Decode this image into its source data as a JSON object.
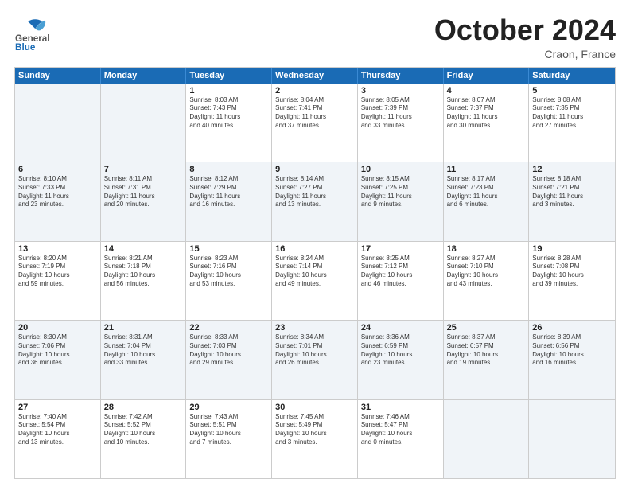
{
  "header": {
    "logo_general": "General",
    "logo_blue": "Blue",
    "month_title": "October 2024",
    "location": "Craon, France"
  },
  "calendar": {
    "days": [
      "Sunday",
      "Monday",
      "Tuesday",
      "Wednesday",
      "Thursday",
      "Friday",
      "Saturday"
    ],
    "rows": [
      [
        {
          "day": "",
          "info": ""
        },
        {
          "day": "",
          "info": ""
        },
        {
          "day": "1",
          "info": "Sunrise: 8:03 AM\nSunset: 7:43 PM\nDaylight: 11 hours\nand 40 minutes."
        },
        {
          "day": "2",
          "info": "Sunrise: 8:04 AM\nSunset: 7:41 PM\nDaylight: 11 hours\nand 37 minutes."
        },
        {
          "day": "3",
          "info": "Sunrise: 8:05 AM\nSunset: 7:39 PM\nDaylight: 11 hours\nand 33 minutes."
        },
        {
          "day": "4",
          "info": "Sunrise: 8:07 AM\nSunset: 7:37 PM\nDaylight: 11 hours\nand 30 minutes."
        },
        {
          "day": "5",
          "info": "Sunrise: 8:08 AM\nSunset: 7:35 PM\nDaylight: 11 hours\nand 27 minutes."
        }
      ],
      [
        {
          "day": "6",
          "info": "Sunrise: 8:10 AM\nSunset: 7:33 PM\nDaylight: 11 hours\nand 23 minutes."
        },
        {
          "day": "7",
          "info": "Sunrise: 8:11 AM\nSunset: 7:31 PM\nDaylight: 11 hours\nand 20 minutes."
        },
        {
          "day": "8",
          "info": "Sunrise: 8:12 AM\nSunset: 7:29 PM\nDaylight: 11 hours\nand 16 minutes."
        },
        {
          "day": "9",
          "info": "Sunrise: 8:14 AM\nSunset: 7:27 PM\nDaylight: 11 hours\nand 13 minutes."
        },
        {
          "day": "10",
          "info": "Sunrise: 8:15 AM\nSunset: 7:25 PM\nDaylight: 11 hours\nand 9 minutes."
        },
        {
          "day": "11",
          "info": "Sunrise: 8:17 AM\nSunset: 7:23 PM\nDaylight: 11 hours\nand 6 minutes."
        },
        {
          "day": "12",
          "info": "Sunrise: 8:18 AM\nSunset: 7:21 PM\nDaylight: 11 hours\nand 3 minutes."
        }
      ],
      [
        {
          "day": "13",
          "info": "Sunrise: 8:20 AM\nSunset: 7:19 PM\nDaylight: 10 hours\nand 59 minutes."
        },
        {
          "day": "14",
          "info": "Sunrise: 8:21 AM\nSunset: 7:18 PM\nDaylight: 10 hours\nand 56 minutes."
        },
        {
          "day": "15",
          "info": "Sunrise: 8:23 AM\nSunset: 7:16 PM\nDaylight: 10 hours\nand 53 minutes."
        },
        {
          "day": "16",
          "info": "Sunrise: 8:24 AM\nSunset: 7:14 PM\nDaylight: 10 hours\nand 49 minutes."
        },
        {
          "day": "17",
          "info": "Sunrise: 8:25 AM\nSunset: 7:12 PM\nDaylight: 10 hours\nand 46 minutes."
        },
        {
          "day": "18",
          "info": "Sunrise: 8:27 AM\nSunset: 7:10 PM\nDaylight: 10 hours\nand 43 minutes."
        },
        {
          "day": "19",
          "info": "Sunrise: 8:28 AM\nSunset: 7:08 PM\nDaylight: 10 hours\nand 39 minutes."
        }
      ],
      [
        {
          "day": "20",
          "info": "Sunrise: 8:30 AM\nSunset: 7:06 PM\nDaylight: 10 hours\nand 36 minutes."
        },
        {
          "day": "21",
          "info": "Sunrise: 8:31 AM\nSunset: 7:04 PM\nDaylight: 10 hours\nand 33 minutes."
        },
        {
          "day": "22",
          "info": "Sunrise: 8:33 AM\nSunset: 7:03 PM\nDaylight: 10 hours\nand 29 minutes."
        },
        {
          "day": "23",
          "info": "Sunrise: 8:34 AM\nSunset: 7:01 PM\nDaylight: 10 hours\nand 26 minutes."
        },
        {
          "day": "24",
          "info": "Sunrise: 8:36 AM\nSunset: 6:59 PM\nDaylight: 10 hours\nand 23 minutes."
        },
        {
          "day": "25",
          "info": "Sunrise: 8:37 AM\nSunset: 6:57 PM\nDaylight: 10 hours\nand 19 minutes."
        },
        {
          "day": "26",
          "info": "Sunrise: 8:39 AM\nSunset: 6:56 PM\nDaylight: 10 hours\nand 16 minutes."
        }
      ],
      [
        {
          "day": "27",
          "info": "Sunrise: 7:40 AM\nSunset: 5:54 PM\nDaylight: 10 hours\nand 13 minutes."
        },
        {
          "day": "28",
          "info": "Sunrise: 7:42 AM\nSunset: 5:52 PM\nDaylight: 10 hours\nand 10 minutes."
        },
        {
          "day": "29",
          "info": "Sunrise: 7:43 AM\nSunset: 5:51 PM\nDaylight: 10 hours\nand 7 minutes."
        },
        {
          "day": "30",
          "info": "Sunrise: 7:45 AM\nSunset: 5:49 PM\nDaylight: 10 hours\nand 3 minutes."
        },
        {
          "day": "31",
          "info": "Sunrise: 7:46 AM\nSunset: 5:47 PM\nDaylight: 10 hours\nand 0 minutes."
        },
        {
          "day": "",
          "info": ""
        },
        {
          "day": "",
          "info": ""
        }
      ]
    ]
  }
}
